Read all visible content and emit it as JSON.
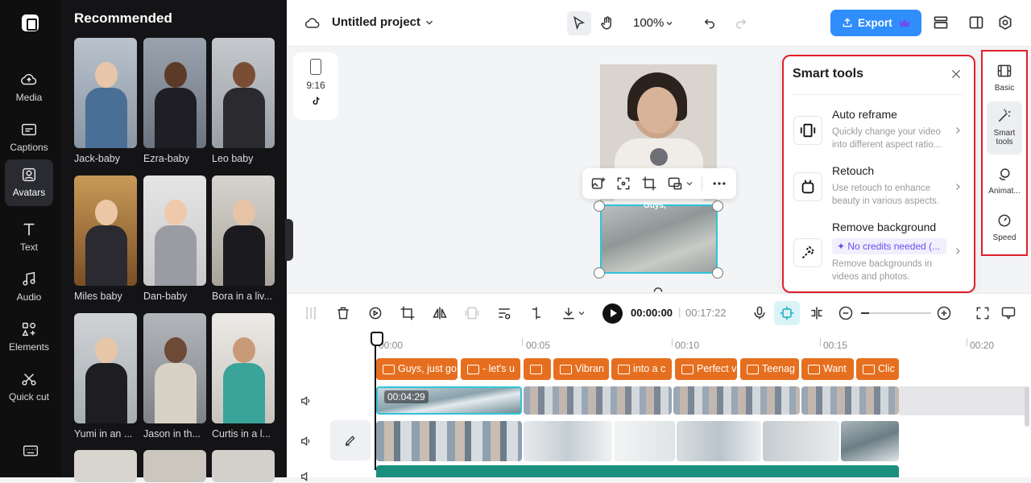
{
  "rail": {
    "items": [
      {
        "label": "Media",
        "icon": "cloud-upload-icon"
      },
      {
        "label": "Captions",
        "icon": "captions-icon"
      },
      {
        "label": "Avatars",
        "icon": "avatar-icon"
      },
      {
        "label": "Text",
        "icon": "text-icon"
      },
      {
        "label": "Audio",
        "icon": "music-note-icon"
      },
      {
        "label": "Elements",
        "icon": "elements-icon"
      },
      {
        "label": "Quick cut",
        "icon": "scissors-icon"
      }
    ],
    "active": "Avatars",
    "keyboard_icon": "keyboard-icon"
  },
  "panel": {
    "title": "Recommended",
    "avatars": [
      {
        "name": "Jack-baby"
      },
      {
        "name": "Ezra-baby"
      },
      {
        "name": "Leo baby"
      },
      {
        "name": "Miles baby"
      },
      {
        "name": "Dan-baby"
      },
      {
        "name": "Bora in a liv..."
      },
      {
        "name": "Yumi in an ..."
      },
      {
        "name": "Jason in th..."
      },
      {
        "name": "Curtis in a l..."
      }
    ]
  },
  "topbar": {
    "project_name": "Untitled project",
    "zoom": "100%",
    "export_label": "Export"
  },
  "canvas": {
    "ratio_label": "9:16",
    "caption_text": "Guys,"
  },
  "smart_tools": {
    "title": "Smart tools",
    "items": [
      {
        "title": "Auto reframe",
        "desc": "Quickly change your video into different aspect ratio..."
      },
      {
        "title": "Retouch",
        "desc": "Use retouch to enhance beauty in various aspects."
      },
      {
        "title": "Remove background",
        "badge": "No credits needed (...",
        "desc": "Remove backgrounds in videos and photos."
      }
    ]
  },
  "right_rail": {
    "items": [
      {
        "label": "Basic"
      },
      {
        "label": "Smart tools"
      },
      {
        "label": "Animat..."
      },
      {
        "label": "Speed"
      }
    ],
    "active": "Smart tools"
  },
  "timeline": {
    "current_time": "00:00:00",
    "total_time": "00:17:22",
    "ruler": [
      "00:00",
      "00:05",
      "00:10",
      "00:15",
      "00:20"
    ],
    "captions": [
      "Guys, just go",
      "- let's u",
      "",
      "Vibran",
      "into a c",
      "Perfect v",
      "Teenag",
      "Want",
      "Clic"
    ],
    "selected_clip_duration": "00:04:29"
  }
}
